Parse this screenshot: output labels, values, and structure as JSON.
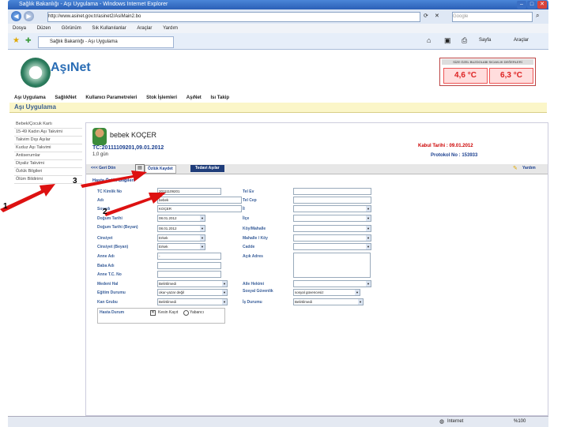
{
  "window": {
    "title": "Sağlık Bakanlığı - Aşı Uygulama - Windows Internet Explorer",
    "address": "http://www.asinet.gov.tr/asinet2/AsiMain2.bo",
    "search_placeholder": "Google"
  },
  "menu": [
    "Dosya",
    "Düzen",
    "Görünüm",
    "Sık Kullanılanlar",
    "Araçlar",
    "Yardım"
  ],
  "tab_label": "Sağlık Bakanlığı - Aşı Uygulama",
  "toolbar_right": {
    "sayfa": "Sayfa",
    "araclar": "Araçlar"
  },
  "brand": "AşıNet",
  "thermometer": {
    "caption": "SİZE ÖZEL BUZDOLABI SICAKLIK DEĞERLERİ",
    "t1": "4,6 °C",
    "t2": "6,3 °C"
  },
  "main_nav": [
    "Aşı Uygulama",
    "SağlıkNet",
    "Kullanıcı Parametreleri",
    "Stok İşlemleri",
    "AşıNet",
    "Isı Takip"
  ],
  "page_header": "Aşı Uygulama",
  "sidebar": [
    "Bebek/Çocuk Kartı",
    "15-49 Kadın Aşı Takvimi",
    "Takvim Dışı Aşılar",
    "Kuduz Aşı Takvimi",
    "Antiserumlar",
    "Diyaliz Takvimi",
    "Özlük Bilgileri",
    "Ölüm Bildirimi"
  ],
  "patient": {
    "name": "bebek KOÇER",
    "tc": "TC:20111109201,09.01.2012",
    "age": "1,0 gün",
    "kabul": "Kabul Tarihi : 09.01.2012",
    "protokol": "Protokol No : 153933"
  },
  "tabbar": {
    "back": "<<< Geri Dön",
    "save": "Özlük Kaydet",
    "tedavi": "Tedavi Aşılar",
    "help": "Yardım"
  },
  "section_title": "Hasta Özlük Bilgileri",
  "form_left": [
    {
      "label": "TC Kimlik No",
      "value": "20111109201",
      "type": "input"
    },
    {
      "label": "Adı",
      "value": "bebek",
      "type": "input"
    },
    {
      "label": "Soyadı",
      "value": "KOÇER",
      "type": "input"
    },
    {
      "label": "Doğum Tarihi",
      "value": "08.01.2012",
      "type": "select"
    },
    {
      "label": "Doğum Tarihi (Beyan)",
      "value": "08.01.2012",
      "type": "select"
    },
    {
      "label": "Cinsiyet",
      "value": "Erkek",
      "type": "select"
    },
    {
      "label": "Cinsiyet (Beyan)",
      "value": "Erkek",
      "type": "select"
    },
    {
      "label": "Anne Adı",
      "value": "-",
      "type": "input"
    },
    {
      "label": "Baba Adı",
      "value": "",
      "type": "input"
    },
    {
      "label": "Anne T.C. No",
      "value": "",
      "type": "input"
    },
    {
      "label": "Medeni Hal",
      "value": "Belirtilmedi",
      "type": "select"
    },
    {
      "label": "Eğitim Durumu",
      "value": "okur-yazar değil",
      "type": "select"
    },
    {
      "label": "Kan Grubu",
      "value": "Belirtilmedi",
      "type": "select"
    }
  ],
  "form_right": [
    {
      "label": "Tel Ev",
      "value": "",
      "type": "input"
    },
    {
      "label": "Tel Cep",
      "value": "",
      "type": "input"
    },
    {
      "label": "İl",
      "value": "",
      "type": "select"
    },
    {
      "label": "İlçe",
      "value": "",
      "type": "select"
    },
    {
      "label": "Köy/Mahalle",
      "value": "",
      "type": "select"
    },
    {
      "label": "Mahalle / Köy",
      "value": "",
      "type": "select"
    },
    {
      "label": "Cadde",
      "value": "",
      "type": "select"
    },
    {
      "label": "Açık Adres",
      "value": "",
      "type": "textarea"
    },
    {
      "label": "Aile Hekimi",
      "value": "",
      "type": "select"
    },
    {
      "label": "Sosyal Güvenlik",
      "value": "sosyal güvencesiz",
      "type": "select"
    },
    {
      "label": "İş Durumu",
      "value": "Belirtilmedi",
      "type": "select"
    }
  ],
  "hasta_durum": {
    "label": "Hasta Durum",
    "opt1": "Kesin Kayıt",
    "opt2": "Yabancı"
  },
  "markers": {
    "one": "1",
    "two": "2",
    "three": "3"
  },
  "status": {
    "zone": "Internet",
    "zoom": "%100"
  },
  "colors": {
    "accent": "#2a6db5",
    "alert": "#cc0000",
    "arrow": "#dd1111"
  }
}
